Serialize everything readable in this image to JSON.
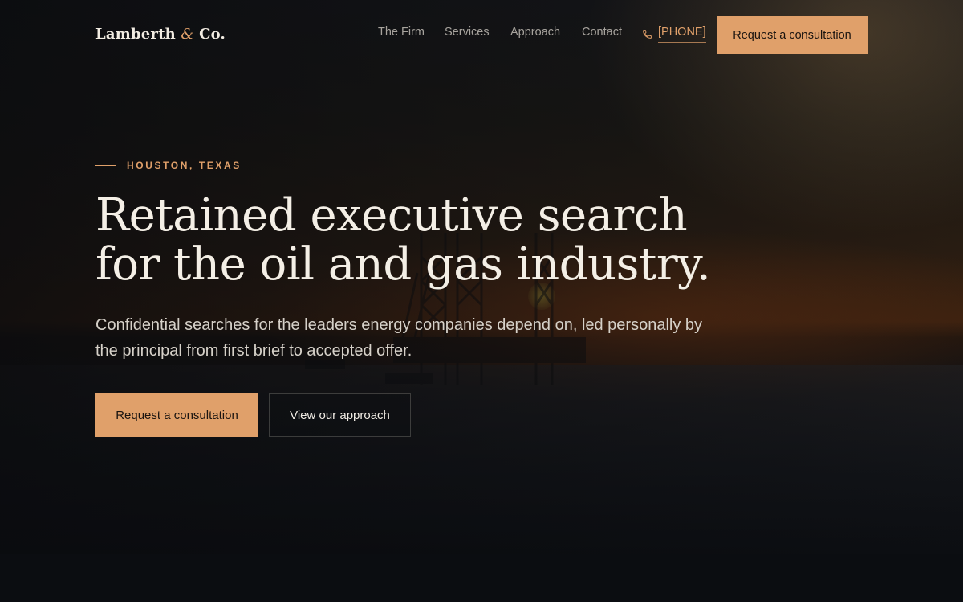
{
  "brand": {
    "name_part1": "Lamberth",
    "ampersand": "&",
    "name_part2": "Co."
  },
  "nav": {
    "links": [
      {
        "label": "The Firm"
      },
      {
        "label": "Services"
      },
      {
        "label": "Approach"
      },
      {
        "label": "Contact"
      }
    ],
    "phone": {
      "label": "[PHONE]",
      "icon": "phone-icon"
    },
    "cta_label": "Request a consultation"
  },
  "hero": {
    "eyebrow": "HOUSTON, TEXAS",
    "headline_line1": "Retained executive search",
    "headline_line2": "for the oil and gas industry.",
    "subhead": "Confidential searches for the leaders energy companies depend on, led personally by the principal from first brief to accepted offer.",
    "primary_cta": "Request a consultation",
    "secondary_cta": "View our approach"
  },
  "colors": {
    "accent": "#e0a06a",
    "background": "#0b0d11",
    "headline": "#f4efe6",
    "nav_text": "#a7a39d"
  }
}
